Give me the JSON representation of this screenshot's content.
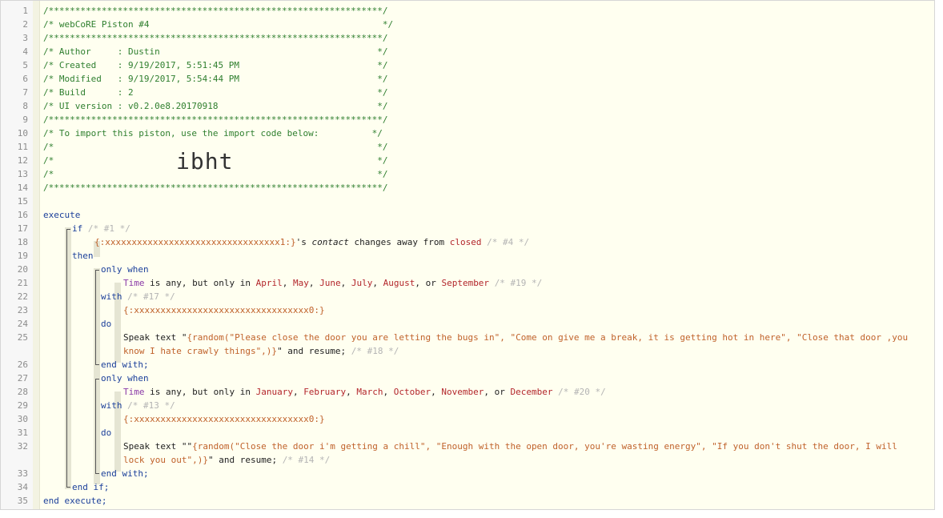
{
  "lines": [
    {
      "n": "1",
      "text": "/***************************************************************/"
    },
    {
      "n": "2",
      "text": "/* webCoRE Piston #4                                            */"
    },
    {
      "n": "3",
      "text": "/***************************************************************/"
    },
    {
      "n": "4",
      "text": "/* Author     : Dustin                                         */"
    },
    {
      "n": "5",
      "text": "/* Created    : 9/19/2017, 5:51:45 PM                          */"
    },
    {
      "n": "6",
      "text": "/* Modified   : 9/19/2017, 5:54:44 PM                          */"
    },
    {
      "n": "7",
      "text": "/* Build      : 2                                              */"
    },
    {
      "n": "8",
      "text": "/* UI version : v0.2.0e8.20170918                              */"
    },
    {
      "n": "9",
      "text": "/***************************************************************/"
    },
    {
      "n": "10",
      "text": "/* To import this piston, use the import code below:          */"
    },
    {
      "n": "11",
      "text": "/*                                                             */"
    },
    {
      "n": "12",
      "text": "/*                                                             */"
    },
    {
      "n": "13",
      "text": "/*                                                             */"
    },
    {
      "n": "14",
      "text": "/***************************************************************/"
    }
  ],
  "import_code": "ibht",
  "line_numbers": [
    "15",
    "16",
    "17",
    "18",
    "19",
    "20",
    "21",
    "22",
    "23",
    "24",
    "25",
    "",
    "26",
    "27",
    "28",
    "29",
    "30",
    "31",
    "32",
    "",
    "33",
    "34",
    "35"
  ],
  "code": {
    "execute": "execute",
    "if": "if",
    "if_comment": "/* #1 */",
    "device1": "{:xxxxxxxxxxxxxxxxxxxxxxxxxxxxxxxxx1:}",
    "possessive": "'s ",
    "attr_contact": "contact",
    "changes_away_from": " changes away from ",
    "closed": "closed",
    "cond_comment": "/* #4 */",
    "then": "then",
    "only_when_1": "only when",
    "time_1": "Time",
    "is_any_1": " is any, but only in ",
    "april": "April",
    "may": "May",
    "june": "June",
    "july": "July",
    "august": "August",
    "or_1": ", or ",
    "september": "September",
    "restr_comment_1": "/* #19 */",
    "with_1": "with",
    "with_comment_1": "/* #17 */",
    "device0_1": "{:xxxxxxxxxxxxxxxxxxxxxxxxxxxxxxxxx0:}",
    "do_1": "do",
    "speak_1": "Speak text \"",
    "random_1": "{random(\"Please close the door you are letting the bugs in\", \"Come on give me a break, it is getting hot in here\", \"Close that door ,you know I hate crawly things\",)}",
    "resume_1": "\" and resume; ",
    "task_comment_1": "/* #18 */",
    "end_with_1": "end with;",
    "only_when_2": "only when",
    "time_2": "Time",
    "is_any_2": " is any, but only in ",
    "january": "January",
    "february": "February",
    "march": "March",
    "october": "October",
    "november": "November",
    "or_2": ", or ",
    "december": "December",
    "restr_comment_2": "/* #20 */",
    "with_2": "with",
    "with_comment_2": "/* #13 */",
    "device0_2": "{:xxxxxxxxxxxxxxxxxxxxxxxxxxxxxxxxx0:}",
    "do_2": "do",
    "speak_2": "Speak text \"\"",
    "random_2": "{random(\"Close the door i'm getting a chill\", \"Enough with the open door, you're wasting energy\", \"If you don't shut the door, I will lock you out\",)}",
    "resume_2": "\" and resume; ",
    "task_comment_2": "/* #14 */",
    "end_with_2": "end with;",
    "end_if": "end if;",
    "end_execute": "end execute;"
  },
  "colors": {
    "comment": "#2f7f2f",
    "keyword": "#1b3f9a",
    "device": "#c0622b",
    "value": "#b3262b",
    "background": "#fffff0"
  }
}
